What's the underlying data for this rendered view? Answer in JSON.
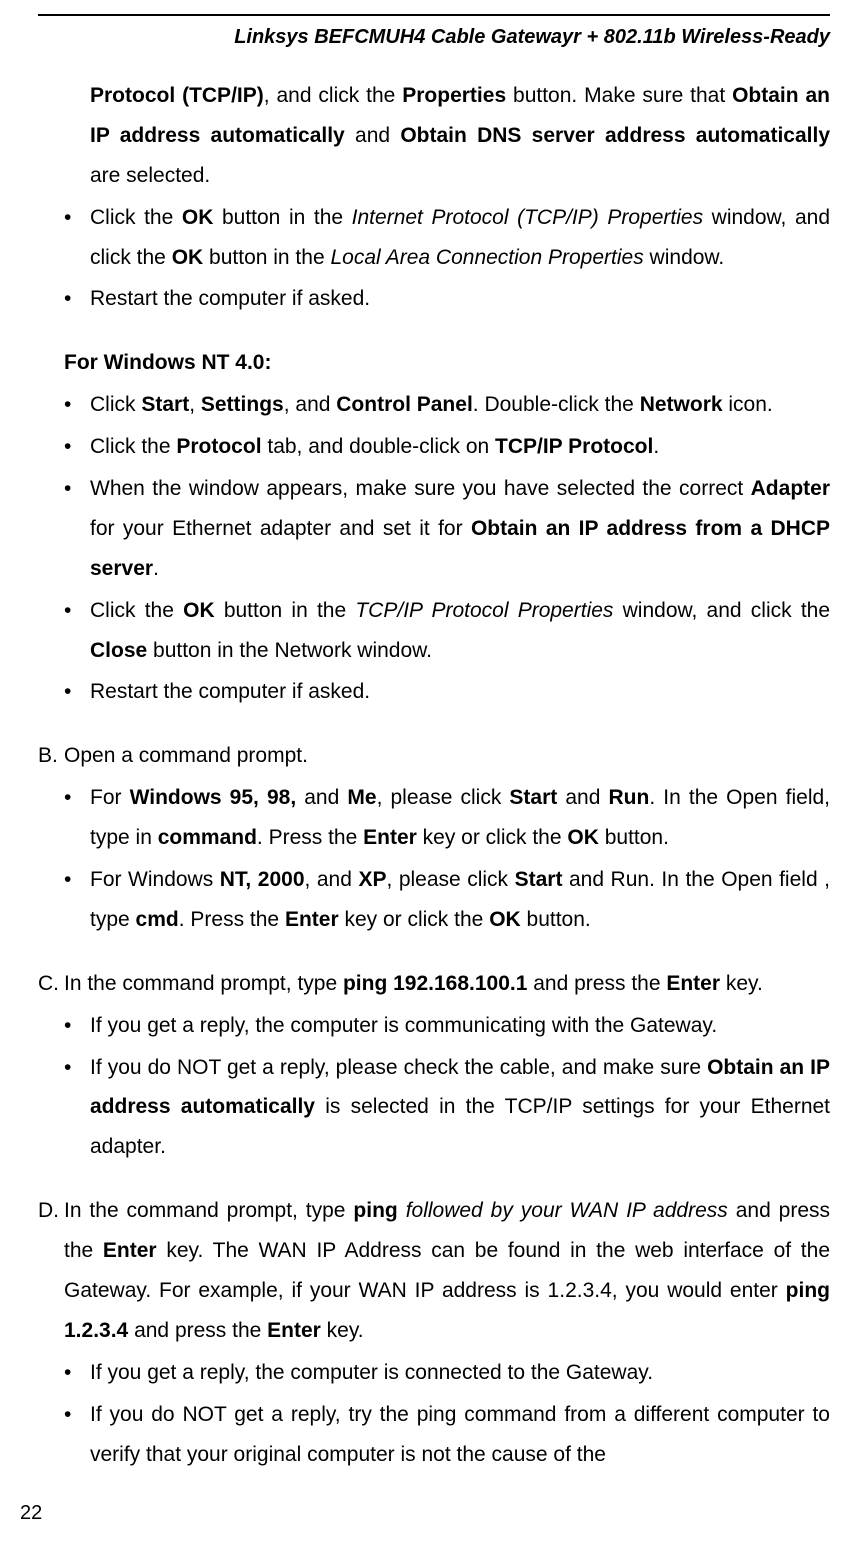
{
  "header": {
    "title": "Linksys BEFCMUH4 Cable Gatewayr + 802.11b Wireless-Ready"
  },
  "content": {
    "para_cont_html": "<b>Protocol (TCP/IP)</b>, and click the <b>Properties</b> button. Make sure that <b>Obtain an IP address automatically</b> and <b>Obtain DNS server address automatically</b> are selected.",
    "bullets_top": [
      "Click the <b>OK</b> button in the <i>Internet Protocol (TCP/IP) Properties</i> window, and click the <b>OK</b> button in the <i>Local Area Connection Properties</i> window.",
      "Restart the computer if asked."
    ],
    "nt_heading": "For Windows NT 4.0:",
    "bullets_nt": [
      "Click <b>Start</b>, <b>Settings</b>, and <b>Control Panel</b>. Double-click the <b>Network</b> icon.",
      "Click the <b>Protocol</b> tab, and double-click on <b>TCP/IP Protocol</b>.",
      "When the window appears, make sure you have selected the correct <b>Adapter</b> for your Ethernet adapter and set it for <b>Obtain an IP address from a DHCP server</b>.",
      "Click the <b>OK</b> button in the <i>TCP/IP Protocol Properties</i> window, and click the <b>Close</b> button in the Network window.",
      "Restart the computer if asked."
    ],
    "letter_b": "Open a command prompt.",
    "bullets_b": [
      "For <b>Windows 95, 98,</b> and <b>Me</b>, please click <b>Start</b> and <b>Run</b>. In the Open field, type in <b>command</b>. Press the <b>Enter</b> key or click the <b>OK</b> button.",
      "For Windows <b>NT, 2000</b>, and <b>XP</b>, please click <b>Start</b> and Run. In the Open field , type <b>cmd</b>. Press the <b>Enter</b> key or click the <b>OK</b> button."
    ],
    "letter_c": "In the command prompt, type <b>ping 192.168.100.1</b> and press the <b>Enter</b> key.",
    "bullets_c": [
      "If you get a reply, the computer is communicating with the Gateway.",
      "If you do NOT get a reply, please check the cable, and make sure <b>Obtain an IP address automatically</b> is selected in the TCP/IP settings for your Ethernet adapter."
    ],
    "letter_d": "In the command prompt, type <b>ping</b> <i>followed by your WAN IP address</i> and press the <b>Enter</b> key. The WAN IP Address can be found in the web interface of the Gateway. For example, if your WAN IP address is 1.2.3.4, you would enter <b>ping 1.2.3.4</b> and press the <b>Enter</b> key.",
    "bullets_d": [
      "If you get a reply, the computer is connected to the Gateway.",
      "If you do NOT get a reply, try the ping command from a different computer to verify that your original computer is not the cause of the"
    ]
  },
  "page_number": "22",
  "bullet_char": "•",
  "letters": {
    "b": "B.",
    "c": "C.",
    "d": "D."
  }
}
